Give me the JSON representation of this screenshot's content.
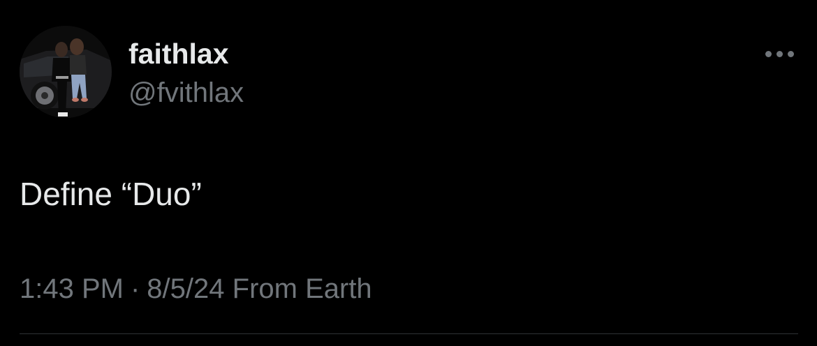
{
  "colors": {
    "background": "#000000",
    "primary_text": "#e7e9ea",
    "secondary_text": "#71767b",
    "divider": "#2f3336"
  },
  "author": {
    "display_name": "faithlax",
    "handle": "@fvithlax"
  },
  "icons": {
    "avatar": "profile-photo",
    "more": "more-options-icon"
  },
  "tweet": {
    "text": "Define “Duo”",
    "time": "1:43 PM",
    "separator": "·",
    "date": "8/5/24",
    "source": "From Earth"
  }
}
